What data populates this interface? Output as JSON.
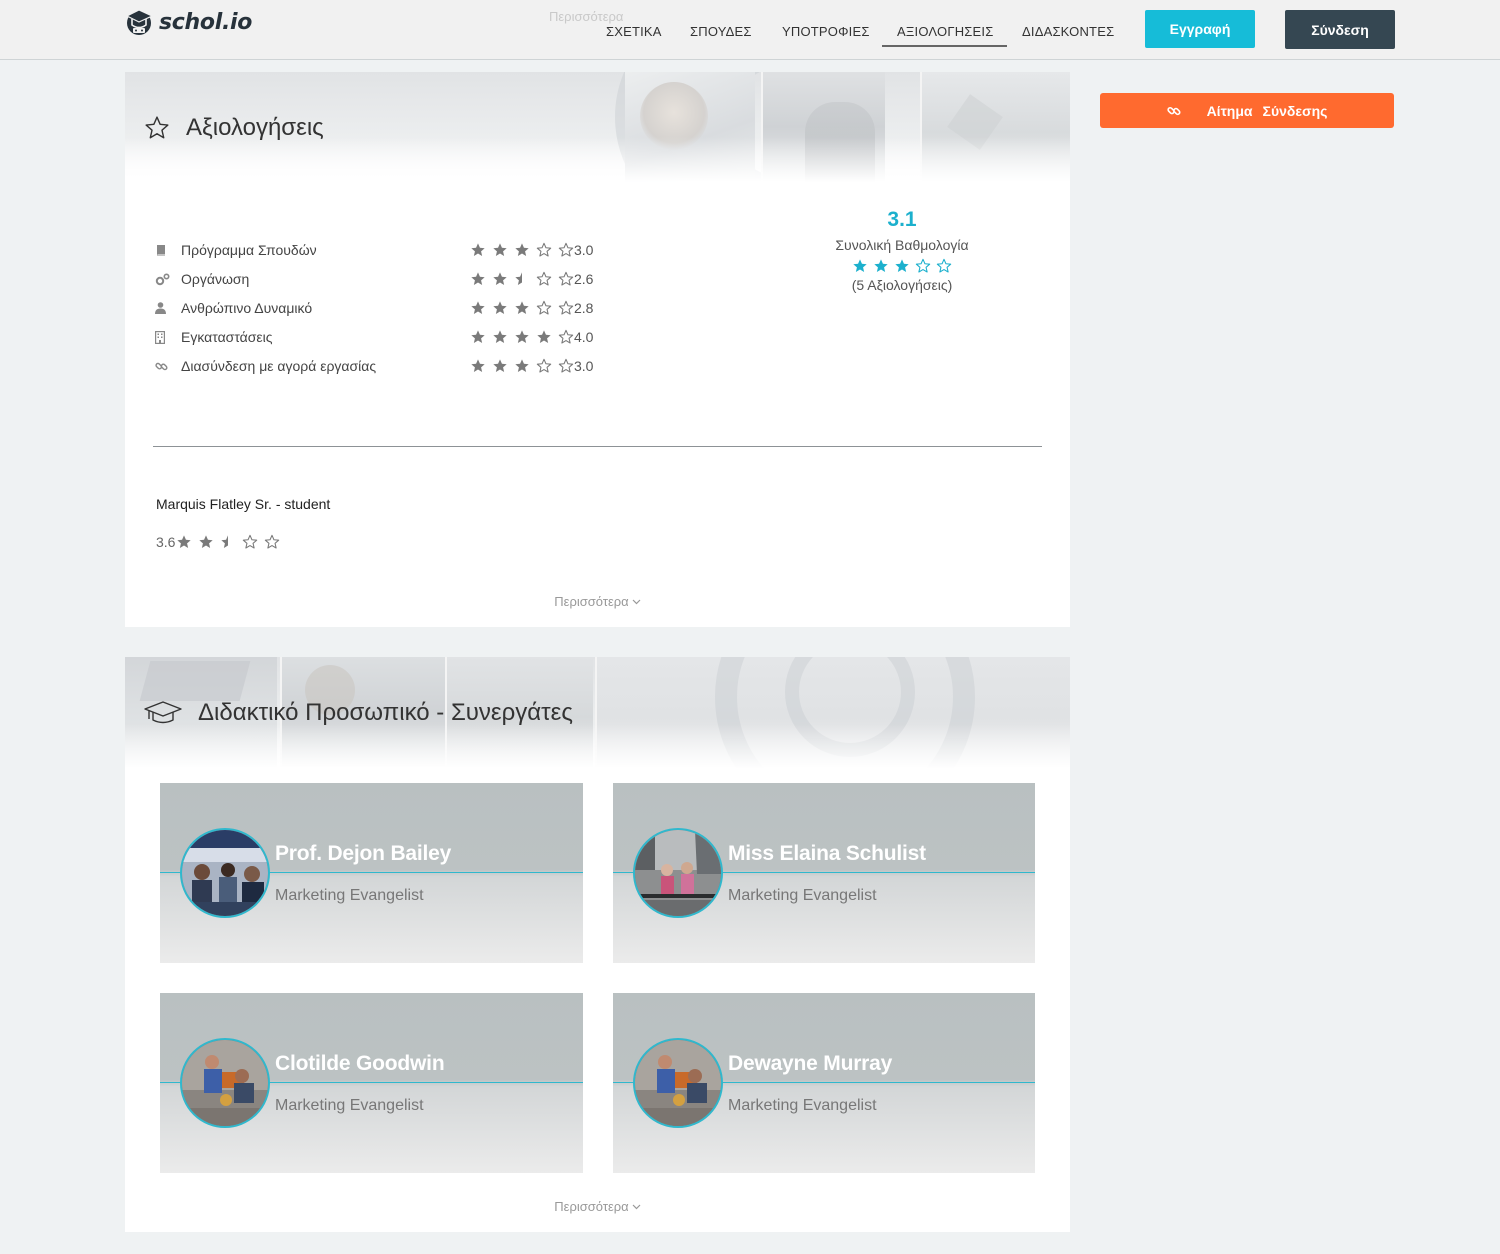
{
  "header": {
    "logo_text": "schol.io",
    "ghost_text": "Περισσότερα",
    "nav": [
      {
        "label": "ΣΧΕΤΙΚΑ",
        "active": false
      },
      {
        "label": "ΣΠΟΥΔΕΣ",
        "active": false
      },
      {
        "label": "ΥΠΟΤΡΟΦΙΕΣ",
        "active": false
      },
      {
        "label": "ΑΞΙΟΛΟΓΗΣΕΙΣ",
        "active": true
      },
      {
        "label": "ΔΙΔΑΣΚΟΝΤΕΣ",
        "active": false
      }
    ],
    "register_label": "Εγγραφή",
    "login_label": "Σύνδεση"
  },
  "sidebar": {
    "request_word1": "Αίτημα",
    "request_word2": "Σύνδεσης"
  },
  "reviews": {
    "title": "Αξιολογήσεις",
    "criteria": [
      {
        "label": "Πρόγραμμα Σπουδών",
        "icon": "book-icon",
        "score": "3.0",
        "rating": 3.0
      },
      {
        "label": "Οργάνωση",
        "icon": "gears-icon",
        "score": "2.6",
        "rating": 2.5
      },
      {
        "label": "Ανθρώπινο Δυναμικό",
        "icon": "user-icon",
        "score": "2.8",
        "rating": 3.0
      },
      {
        "label": "Εγκαταστάσεις",
        "icon": "building-icon",
        "score": "4.0",
        "rating": 4.0
      },
      {
        "label": "Διασύνδεση με αγορά εργασίας",
        "icon": "link-icon",
        "score": "3.0",
        "rating": 3.0
      }
    ],
    "overall": {
      "score": "3.1",
      "label": "Συνολική Βαθμολογία",
      "count": "(5 Αξιολογήσεις)",
      "rating": 3
    },
    "review": {
      "author": "Marquis Flatley Sr. - student",
      "score": "3.6",
      "rating": 2.5
    },
    "more_label": "Περισσότερα"
  },
  "staff": {
    "title": "Διδακτικό Προσωπικό - Συνεργάτες",
    "members": [
      {
        "name": "Prof. Dejon Bailey",
        "role": "Marketing Evangelist"
      },
      {
        "name": "Miss Elaina Schulist",
        "role": "Marketing Evangelist"
      },
      {
        "name": "Clotilde Goodwin",
        "role": "Marketing Evangelist"
      },
      {
        "name": "Dewayne Murray",
        "role": "Marketing Evangelist"
      }
    ],
    "more_label": "Περισσότερα"
  },
  "colors": {
    "accent": "#16bcd8",
    "dark": "#354752",
    "orange": "#ff6a2f",
    "star": "#7a7a7a",
    "overall_star": "#1cb0cd"
  }
}
